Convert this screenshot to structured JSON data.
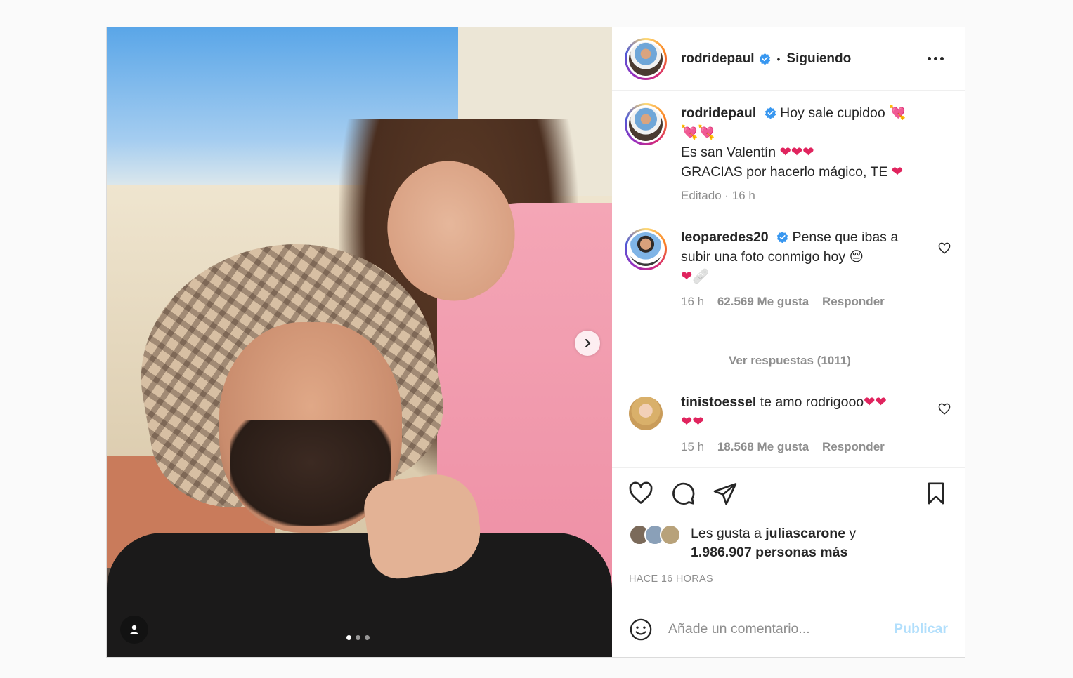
{
  "post": {
    "username": "rodridepaul",
    "follow_label": "Siguiendo",
    "separator": "•",
    "caption": {
      "line1": "Hoy sale cupidoo",
      "line3": "Es san Valentín",
      "line4": "GRACIAS por hacerlo mágico, TE"
    },
    "caption_meta": "Editado · 16 h",
    "media": {
      "dots_total": 3,
      "active_dot": 0
    }
  },
  "comments": [
    {
      "username": "leoparedes20",
      "verified": true,
      "text_line1": "Pense que ibas a",
      "text_line2": "subir una foto conmigo hoy",
      "time": "16 h",
      "likes": "62.569 Me gusta",
      "reply": "Responder"
    },
    {
      "username": "tinistoessel",
      "verified": false,
      "text_line1": "te amo rodrigooo",
      "time": "15 h",
      "likes": "18.568 Me gusta",
      "reply": "Responder"
    }
  ],
  "view_replies": "Ver respuestas (1011)",
  "likes_summary": {
    "prefix": "Les gusta a",
    "user": "juliascarone",
    "joiner": "y",
    "count": "1.986.907 personas más"
  },
  "timestamp": "HACE 16 HORAS",
  "add_comment": {
    "placeholder": "Añade un comentario...",
    "publish_label": "Publicar"
  },
  "colors": {
    "verified": "#3897f0",
    "publish_disabled": "#b2dffc",
    "text_secondary": "#8e8e8e",
    "heart": "#e0245e"
  },
  "icons": [
    "chevron-right-icon",
    "user-tag-icon",
    "more-icon",
    "heart-icon",
    "comment-icon",
    "share-icon",
    "bookmark-icon",
    "emoji-icon",
    "verified-icon"
  ]
}
